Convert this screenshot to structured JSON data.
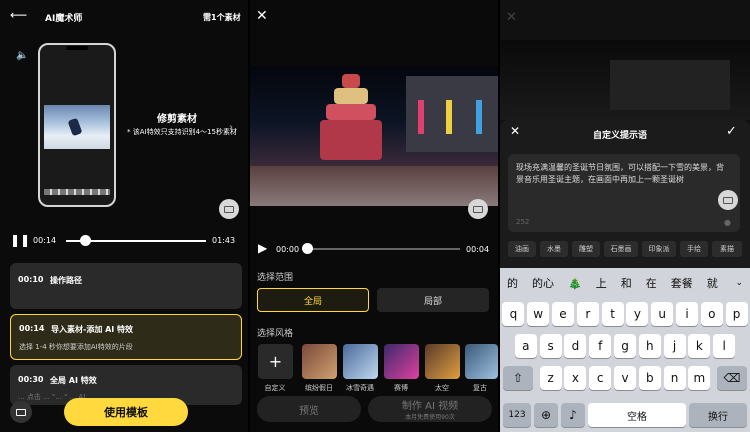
{
  "panel1": {
    "title": "AI魔术师",
    "material_count": "需1个素材",
    "trim_title": "修剪素材",
    "trim_hint": "* 该AI特效只支持识别4～15秒素材",
    "time_current": "00:14",
    "time_total": "01:43",
    "playback_progress": 0.14,
    "steps": [
      {
        "time": "00:10",
        "title": "操作路径",
        "desc": ""
      },
      {
        "time": "00:14",
        "title": "导入素材-添加 AI 特效",
        "desc": "选择 1-4 秒你想要添加AI特效的片段"
      },
      {
        "time": "00:30",
        "title": "全局 AI 特效",
        "desc": "... 点击 ... \"... \" ... AI ..."
      }
    ],
    "use_template_label": "使用模板"
  },
  "panel2": {
    "time_current": "00:00",
    "time_total": "00:04",
    "range_label": "选择范围",
    "range_options": [
      "全局",
      "局部"
    ],
    "range_selected": "全局",
    "style_label": "选择风格",
    "styles": [
      {
        "label": "自定义",
        "color": "#2a2a2a"
      },
      {
        "label": "缤纷假日",
        "color": "#7a4a3a"
      },
      {
        "label": "冰雪奇遇",
        "color": "#4a6a9a"
      },
      {
        "label": "赛博",
        "color": "#3a2a6a"
      },
      {
        "label": "太空",
        "color": "#5a3a2a"
      },
      {
        "label": "复古",
        "color": "#3a5a7a"
      }
    ],
    "preview_label": "预览",
    "make_label": "制作 AI 视频",
    "make_sub": "本月免费使用90次"
  },
  "panel3": {
    "sheet_title": "自定义提示语",
    "prompt_text": "现场充满温馨的圣诞节日氛围，可以搭配一下雪的美景，背景音乐用圣诞主题，在画面中再加上一颗圣诞树",
    "char_count": "252",
    "chips": [
      "油画",
      "水墨",
      "雕塑",
      "石墨画",
      "印象派",
      "手绘",
      "素描"
    ],
    "candidates": [
      "的",
      "的心",
      "🎄",
      "上",
      "和",
      "在",
      "套餐",
      "就"
    ],
    "rows": [
      [
        "q",
        "w",
        "e",
        "r",
        "t",
        "y",
        "u",
        "i",
        "o",
        "p"
      ],
      [
        "a",
        "s",
        "d",
        "f",
        "g",
        "h",
        "j",
        "k",
        "l"
      ],
      [
        "z",
        "x",
        "c",
        "v",
        "b",
        "n",
        "m"
      ]
    ],
    "key_123": "123",
    "key_space": "空格",
    "key_return": "换行"
  }
}
